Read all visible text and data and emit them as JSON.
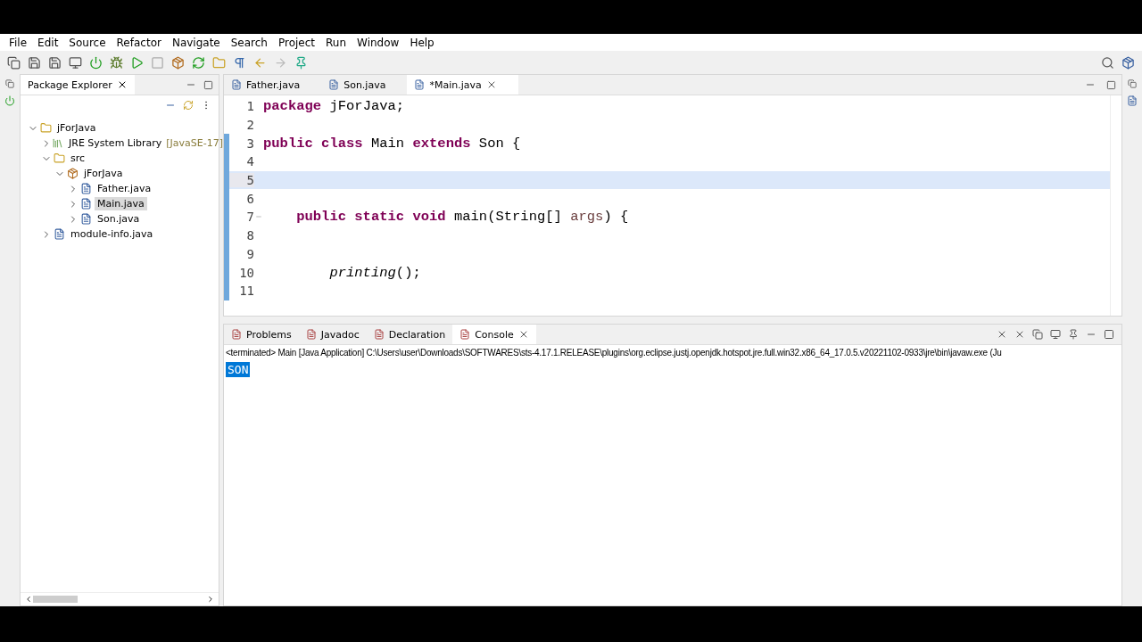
{
  "menu": [
    "File",
    "Edit",
    "Source",
    "Refactor",
    "Navigate",
    "Search",
    "Project",
    "Run",
    "Window",
    "Help"
  ],
  "package_explorer": {
    "title": "Package Explorer",
    "tree": [
      {
        "label": "jForJava",
        "kind": "project",
        "expanded": true,
        "selected": false,
        "children": [
          {
            "label": "JRE System Library",
            "suffix": "[JavaSE-17]",
            "kind": "library",
            "expanded": false,
            "selected": false
          },
          {
            "label": "src",
            "kind": "folder",
            "expanded": true,
            "selected": false,
            "children": [
              {
                "label": "jForJava",
                "kind": "package",
                "expanded": true,
                "selected": false,
                "children": [
                  {
                    "label": "Father.java",
                    "kind": "file",
                    "expanded": false,
                    "selected": false
                  },
                  {
                    "label": "Main.java",
                    "kind": "file",
                    "expanded": false,
                    "selected": true
                  },
                  {
                    "label": "Son.java",
                    "kind": "file",
                    "expanded": false,
                    "selected": false
                  }
                ]
              }
            ]
          },
          {
            "label": "module-info.java",
            "kind": "file",
            "expanded": false,
            "selected": false
          }
        ]
      }
    ]
  },
  "editor": {
    "tabs": [
      {
        "label": "Father.java",
        "selected": false
      },
      {
        "label": "Son.java",
        "selected": false
      },
      {
        "label": "*Main.java",
        "selected": true
      }
    ],
    "lines": [
      {
        "number": "1",
        "current": false,
        "changed": false,
        "tokens": [
          {
            "kind": "keyword",
            "text": "package"
          },
          {
            "kind": "plain",
            "text": " jForJava;"
          }
        ]
      },
      {
        "number": "2",
        "current": false,
        "changed": false
      },
      {
        "number": "3",
        "current": false,
        "changed": true,
        "tokens": [
          {
            "kind": "keyword",
            "text": "public class"
          },
          {
            "kind": "plain",
            "text": " Main "
          },
          {
            "kind": "keyword",
            "text": "extends"
          },
          {
            "kind": "plain",
            "text": " Son {"
          }
        ]
      },
      {
        "number": "4",
        "current": false,
        "changed": true
      },
      {
        "number": "5",
        "current": true,
        "changed": true
      },
      {
        "number": "6",
        "current": false,
        "changed": true
      },
      {
        "number": "7",
        "current": false,
        "changed": true,
        "foldable": true,
        "tokens": [
          {
            "kind": "keyword",
            "text": "    public static void"
          },
          {
            "kind": "plain",
            "text": " main(String[] "
          },
          {
            "kind": "param",
            "text": "args"
          },
          {
            "kind": "plain",
            "text": ") {"
          }
        ]
      },
      {
        "number": "8",
        "current": false,
        "changed": true
      },
      {
        "number": "9",
        "current": false,
        "changed": true
      },
      {
        "number": "10",
        "current": false,
        "changed": true,
        "tokens": [
          {
            "kind": "method",
            "text": "        printing"
          },
          {
            "kind": "plain",
            "text": "();"
          }
        ]
      },
      {
        "number": "11",
        "current": false,
        "changed": true
      }
    ]
  },
  "bottom_panel": {
    "tabs": [
      {
        "label": "Problems",
        "selected": false
      },
      {
        "label": "Javadoc",
        "selected": false
      },
      {
        "label": "Declaration",
        "selected": false
      },
      {
        "label": "Console",
        "selected": true
      }
    ],
    "console_header": "<terminated> Main [Java Application] C:\\Users\\user\\Downloads\\SOFTWARES\\sts-4.17.1.RELEASE\\plugins\\org.eclipse.justj.openjdk.hotspot.jre.full.win32.x86_64_17.0.5.v20221102-0933\\jre\\bin\\javaw.exe  (Ju",
    "output": [
      {
        "text": "SON",
        "selected": true
      }
    ]
  }
}
